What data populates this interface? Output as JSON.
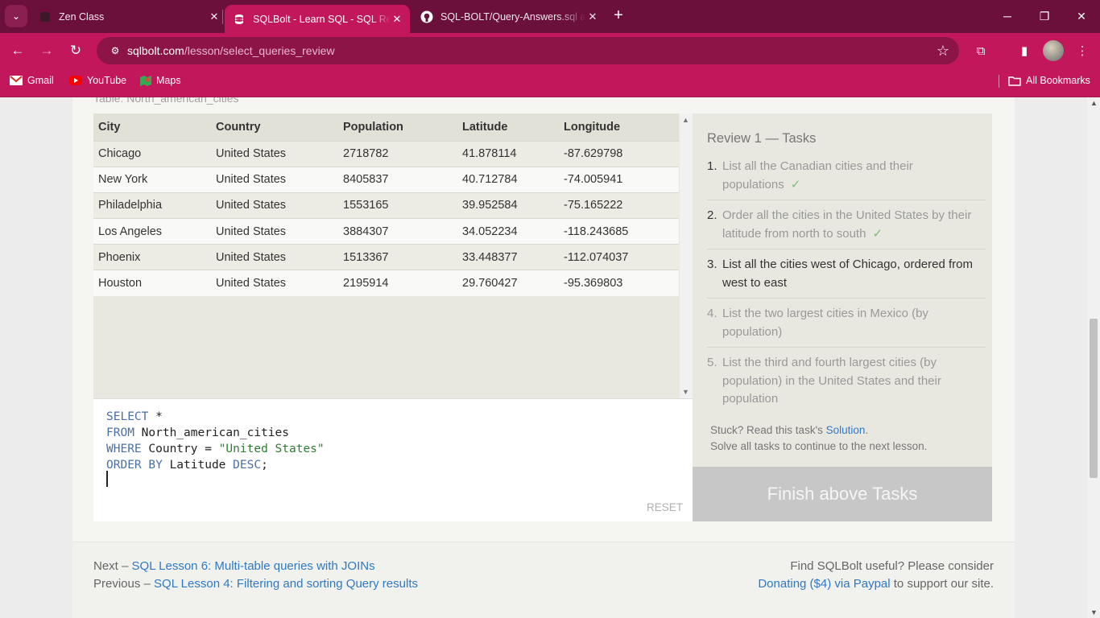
{
  "browser": {
    "tabs": [
      {
        "title": "Zen Class",
        "active": false
      },
      {
        "title": "SQLBolt - Learn SQL - SQL Review",
        "active": true
      },
      {
        "title": "SQL-BOLT/Query-Answers.sql at",
        "active": false
      }
    ],
    "url_host": "sqlbolt.com",
    "url_path": "/lesson/select_queries_review",
    "bookmarks": [
      {
        "label": "Gmail"
      },
      {
        "label": "YouTube"
      },
      {
        "label": "Maps"
      }
    ],
    "all_bookmarks": "All Bookmarks"
  },
  "page": {
    "table_caption": "Table: North_american_cities",
    "table": {
      "columns": [
        "City",
        "Country",
        "Population",
        "Latitude",
        "Longitude"
      ],
      "rows": [
        [
          "Chicago",
          "United States",
          "2718782",
          "41.878114",
          "-87.629798"
        ],
        [
          "New York",
          "United States",
          "8405837",
          "40.712784",
          "-74.005941"
        ],
        [
          "Philadelphia",
          "United States",
          "1553165",
          "39.952584",
          "-75.165222"
        ],
        [
          "Los Angeles",
          "United States",
          "3884307",
          "34.052234",
          "-118.243685"
        ],
        [
          "Phoenix",
          "United States",
          "1513367",
          "33.448377",
          "-112.074037"
        ],
        [
          "Houston",
          "United States",
          "2195914",
          "29.760427",
          "-95.369803"
        ]
      ]
    },
    "editor": {
      "line1_kw": "SELECT",
      "line1_rest": " *",
      "line2_kw": "FROM",
      "line2_rest": " North_american_cities",
      "line3_kw": "WHERE",
      "line3_mid": " Country = ",
      "line3_str": "\"United States\"",
      "line4_kw1": "ORDER BY",
      "line4_mid": " Latitude ",
      "line4_kw2": "DESC",
      "line4_end": ";",
      "reset": "RESET"
    },
    "tasks": {
      "title": "Review 1 — Tasks",
      "items": [
        {
          "num": "1.",
          "text": "List all the Canadian cities and their populations",
          "check": "✓"
        },
        {
          "num": "2.",
          "text": "Order all the cities in the United States by their latitude from north to south",
          "check": "✓"
        },
        {
          "num": "3.",
          "text": "List all the cities west of Chicago, ordered from west to east"
        },
        {
          "num": "4.",
          "text": "List the two largest cities in Mexico (by population)"
        },
        {
          "num": "5.",
          "text": "List the third and fourth largest cities (by population) in the United States and their population"
        }
      ],
      "stuck_prefix": "Stuck? Read this task's ",
      "stuck_link": "Solution",
      "stuck_suffix": ".",
      "solve_all": "Solve all tasks to continue to the next lesson.",
      "finish_button": "Finish above Tasks"
    },
    "footer": {
      "next_prefix": "Next – ",
      "next_link": "SQL Lesson 6: Multi-table queries with JOINs",
      "prev_prefix": "Previous – ",
      "prev_link": "SQL Lesson 4: Filtering and sorting Query results",
      "useful": "Find SQLBolt useful? Please consider",
      "donate_link": "Donating ($4) via Paypal",
      "donate_suffix": " to support our site."
    }
  },
  "colors": {
    "tabbar": "#6b0f3b",
    "toolbar": "#c2185b",
    "link": "#2f79c4",
    "check": "#7cbf7c"
  }
}
